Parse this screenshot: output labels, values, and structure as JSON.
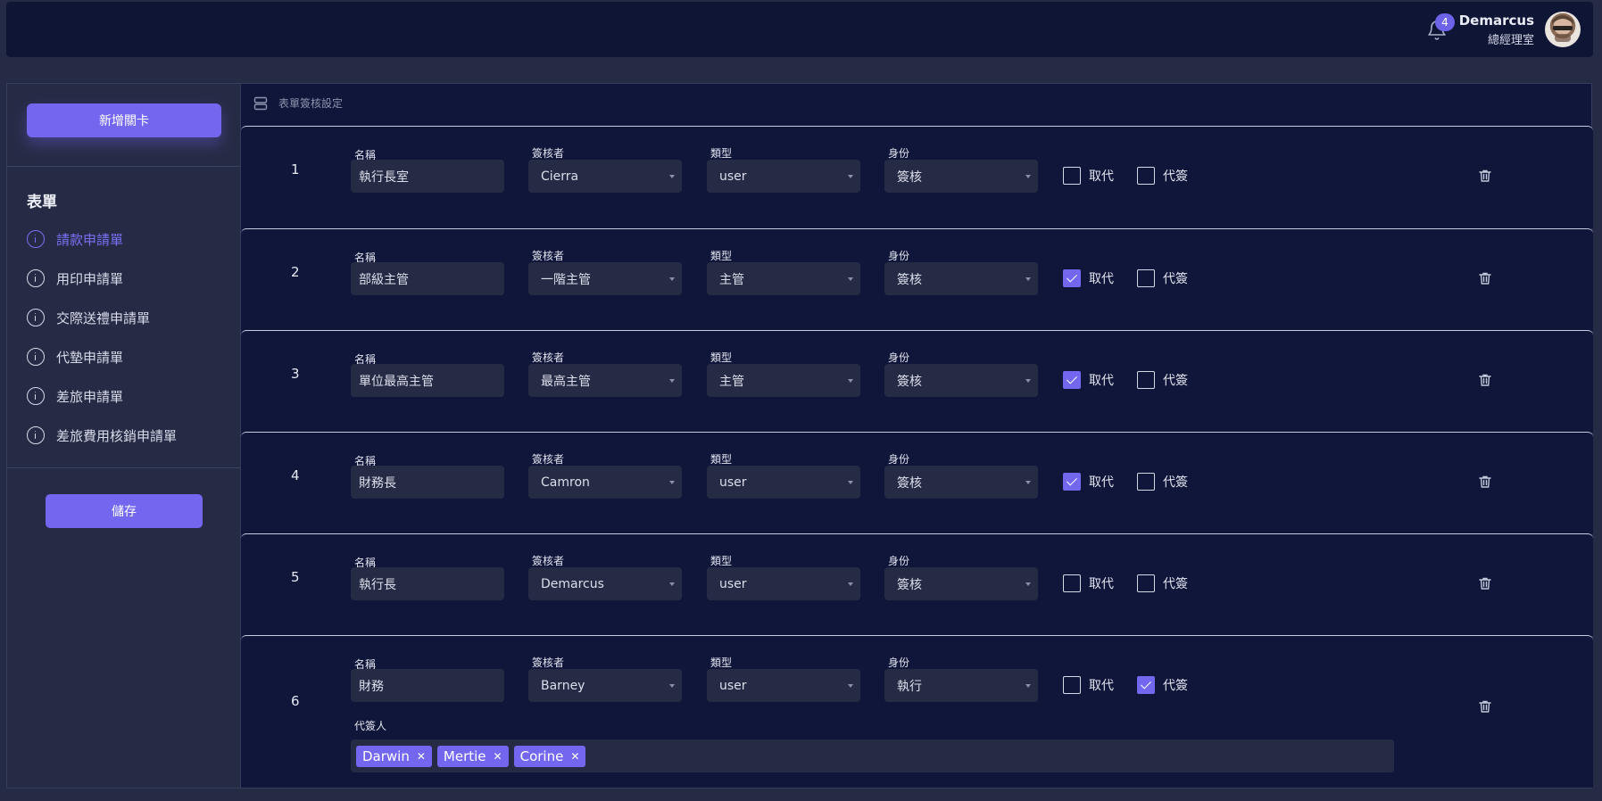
{
  "header": {
    "notification_count": "4",
    "user_name": "Demarcus",
    "user_dept": "總經理室"
  },
  "sidebar": {
    "add_button": "新增關卡",
    "heading": "表單",
    "items": [
      {
        "label": "請款申請單",
        "active": true
      },
      {
        "label": "用印申請單",
        "active": false
      },
      {
        "label": "交際送禮申請單",
        "active": false
      },
      {
        "label": "代墊申請單",
        "active": false
      },
      {
        "label": "差旅申請單",
        "active": false
      },
      {
        "label": "差旅費用核銷申請單",
        "active": false
      }
    ],
    "save_button": "儲存"
  },
  "main": {
    "title": "表單簽核設定",
    "labels": {
      "name": "名稱",
      "approver": "簽核者",
      "type": "類型",
      "identity": "身份",
      "replace": "取代",
      "proxy": "代簽",
      "proxy_people": "代簽人"
    },
    "rows": [
      {
        "num": "1",
        "name": "執行長室",
        "approver": "Cierra",
        "type": "user",
        "identity": "簽核",
        "replace": false,
        "proxy": false
      },
      {
        "num": "2",
        "name": "部級主管",
        "approver": "一階主管",
        "type": "主管",
        "identity": "簽核",
        "replace": true,
        "proxy": false
      },
      {
        "num": "3",
        "name": "單位最高主管",
        "approver": "最高主管",
        "type": "主管",
        "identity": "簽核",
        "replace": true,
        "proxy": false
      },
      {
        "num": "4",
        "name": "財務長",
        "approver": "Camron",
        "type": "user",
        "identity": "簽核",
        "replace": true,
        "proxy": false
      },
      {
        "num": "5",
        "name": "執行長",
        "approver": "Demarcus",
        "type": "user",
        "identity": "簽核",
        "replace": false,
        "proxy": false
      },
      {
        "num": "6",
        "name": "財務",
        "approver": "Barney",
        "type": "user",
        "identity": "執行",
        "replace": false,
        "proxy": true,
        "proxy_people": [
          "Darwin",
          "Mertie",
          "Corine"
        ]
      }
    ]
  },
  "colors": {
    "accent": "#7367f0",
    "background": "#262b45",
    "panel": "#10163a"
  }
}
